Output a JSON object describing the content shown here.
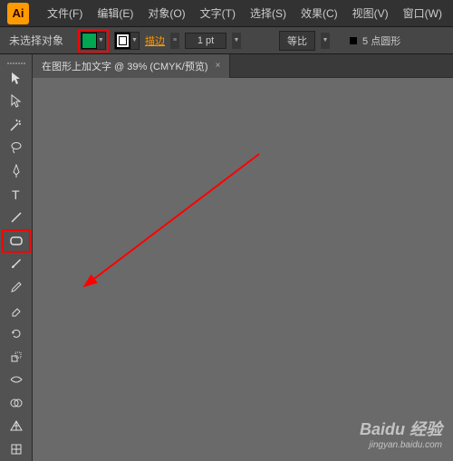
{
  "app": {
    "logo": "Ai"
  },
  "menu": {
    "file": "文件(F)",
    "edit": "编辑(E)",
    "object": "对象(O)",
    "text": "文字(T)",
    "select": "选择(S)",
    "effect": "效果(C)",
    "view": "视图(V)",
    "window": "窗口(W)"
  },
  "options": {
    "status": "未选择对象",
    "fill_color": "#00a651",
    "stroke_label": "描边",
    "stroke_value": "1 pt",
    "scale_label": "等比",
    "shape_caption": "5 点圆形"
  },
  "tab": {
    "title": "在图形上加文字 @ 39% (CMYK/预览)",
    "close": "×"
  },
  "watermark": {
    "main": "Baidu 经验",
    "sub": "jingyan.baidu.com"
  },
  "tools": {
    "selection": "selection",
    "direct": "direct-selection",
    "wand": "magic-wand",
    "lasso": "lasso",
    "pen": "pen",
    "type": "type",
    "line": "line",
    "shape": "rectangle",
    "brush": "brush",
    "pencil": "pencil",
    "eraser": "eraser",
    "rotate": "rotate",
    "scale": "scale",
    "width": "width",
    "warp": "shape-builder",
    "perspective": "perspective",
    "mesh": "mesh",
    "gradient": "gradient"
  }
}
